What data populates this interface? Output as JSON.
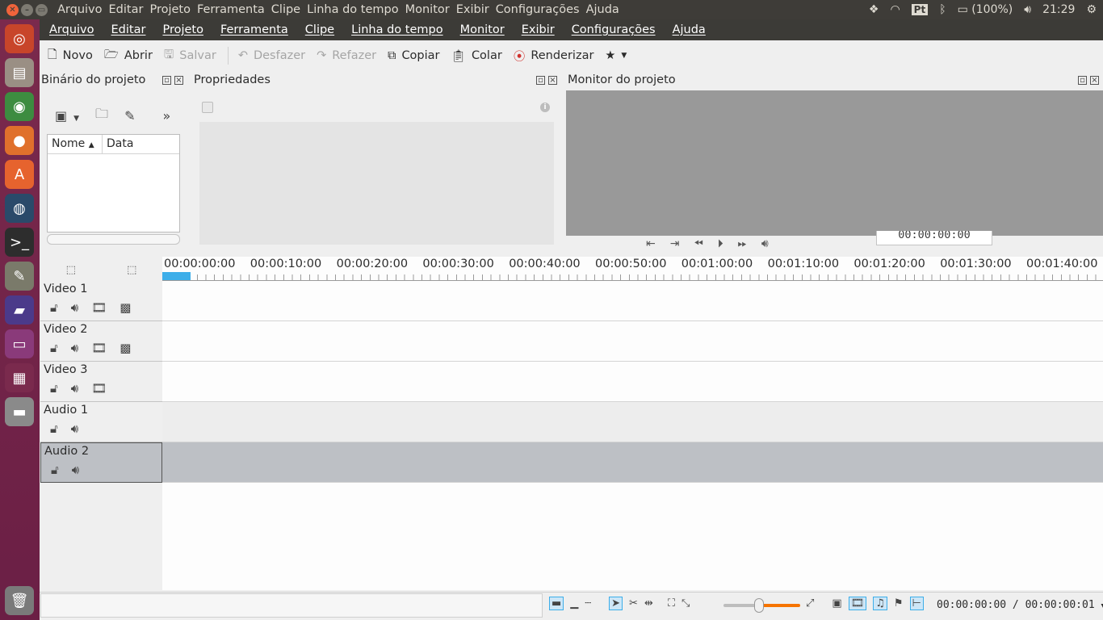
{
  "topbar": {
    "menus": [
      "Arquivo",
      "Editar",
      "Projeto",
      "Ferramenta",
      "Clipe",
      "Linha do tempo",
      "Monitor",
      "Exibir",
      "Configurações",
      "Ajuda"
    ],
    "lang": "Pt",
    "battery": "(100%)",
    "clock": "21:29"
  },
  "menubar": [
    "Arquivo",
    "Editar",
    "Projeto",
    "Ferramenta",
    "Clipe",
    "Linha do tempo",
    "Monitor",
    "Exibir",
    "Configurações",
    "Ajuda"
  ],
  "toolbar": {
    "new": "Novo",
    "open": "Abrir",
    "save": "Salvar",
    "undo": "Desfazer",
    "redo": "Refazer",
    "copy": "Copiar",
    "paste": "Colar",
    "render": "Renderizar"
  },
  "bin": {
    "title": "Binário do projeto",
    "col_name": "Nome",
    "col_date": "Data"
  },
  "props": {
    "title": "Propriedades"
  },
  "monitor": {
    "title": "Monitor do projeto",
    "timecode": "00:00:00:00"
  },
  "ruler": [
    "00:00:00:00",
    "00:00:10:00",
    "00:00:20:00",
    "00:00:30:00",
    "00:00:40:00",
    "00:00:50:00",
    "00:01:00:00",
    "00:01:10:00",
    "00:01:20:00",
    "00:01:30:00",
    "00:01:40:00"
  ],
  "tracks": [
    {
      "name": "Video 1"
    },
    {
      "name": "Video 2"
    },
    {
      "name": "Video 3"
    },
    {
      "name": "Audio 1"
    },
    {
      "name": "Audio 2"
    }
  ],
  "status": {
    "time": "00:00:00:00 / 00:00:00:01"
  },
  "colors": {
    "accent": "#3daee9",
    "launcher": "#6b1f45",
    "zoom": "#f67400"
  }
}
